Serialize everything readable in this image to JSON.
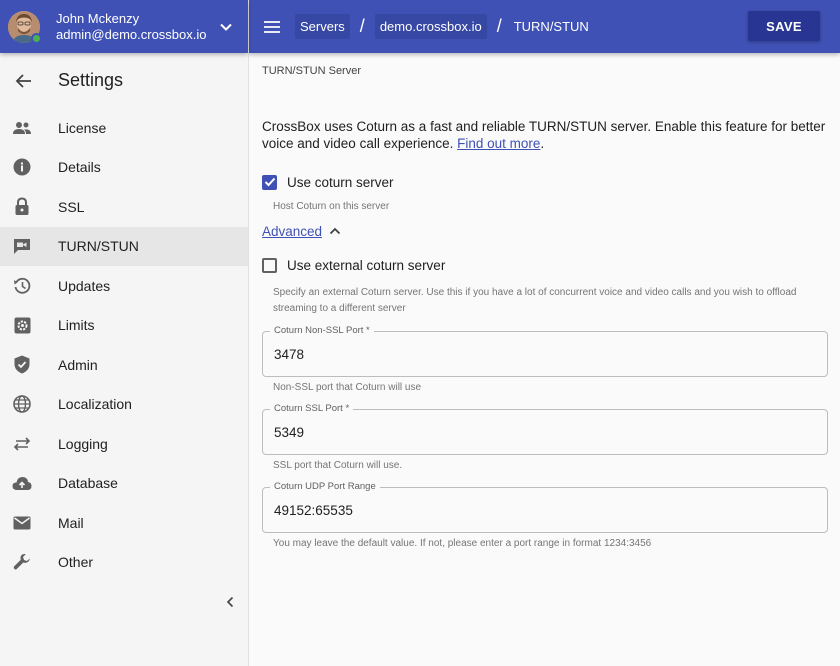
{
  "user": {
    "name": "John Mckenzy",
    "email": "admin@demo.crossbox.io"
  },
  "sidebar": {
    "title": "Settings",
    "items": [
      {
        "label": "License",
        "icon": "people-icon"
      },
      {
        "label": "Details",
        "icon": "info-icon"
      },
      {
        "label": "SSL",
        "icon": "lock-icon"
      },
      {
        "label": "TURN/STUN",
        "icon": "videocam-icon",
        "active": true
      },
      {
        "label": "Updates",
        "icon": "history-icon"
      },
      {
        "label": "Limits",
        "icon": "settings-box-icon"
      },
      {
        "label": "Admin",
        "icon": "shield-icon"
      },
      {
        "label": "Localization",
        "icon": "globe-icon"
      },
      {
        "label": "Logging",
        "icon": "swap-arrows-icon"
      },
      {
        "label": "Database",
        "icon": "cloud-upload-icon"
      },
      {
        "label": "Mail",
        "icon": "mail-icon"
      },
      {
        "label": "Other",
        "icon": "wrench-icon"
      }
    ]
  },
  "topbar": {
    "breadcrumb": [
      "Servers",
      "demo.crossbox.io"
    ],
    "current": "TURN/STUN",
    "save_label": "SAVE"
  },
  "main": {
    "section_title": "TURN/STUN Server",
    "intro": "CrossBox uses Coturn as a fast and reliable TURN/STUN server. Enable this feature for better voice and video call experience.",
    "intro_link": "Find out more",
    "intro_end": ".",
    "use_coturn": {
      "label": "Use coturn server",
      "checked": true,
      "helper": "Host Coturn on this server"
    },
    "advanced_label": "Advanced",
    "use_external": {
      "label": "Use external coturn server",
      "checked": false,
      "helper": "Specify an external Coturn server. Use this if you have a lot of concurrent voice and video calls and you wish to offload streaming to a different server"
    },
    "fields": {
      "non_ssl": {
        "label": "Coturn Non-SSL Port *",
        "value": "3478",
        "helper": "Non-SSL port that Coturn will use"
      },
      "ssl": {
        "label": "Coturn SSL Port *",
        "value": "5349",
        "helper": "SSL port that Coturn will use."
      },
      "udp": {
        "label": "Coturn UDP Port Range",
        "value": "49152:65535",
        "helper": "You may leave the default value. If not, please enter a port range in format 1234:3456"
      }
    }
  },
  "colors": {
    "primary": "#3f51b5",
    "primary_dark": "#283593",
    "crumb_bg": "#3747a4",
    "status_online": "#4caf50"
  }
}
